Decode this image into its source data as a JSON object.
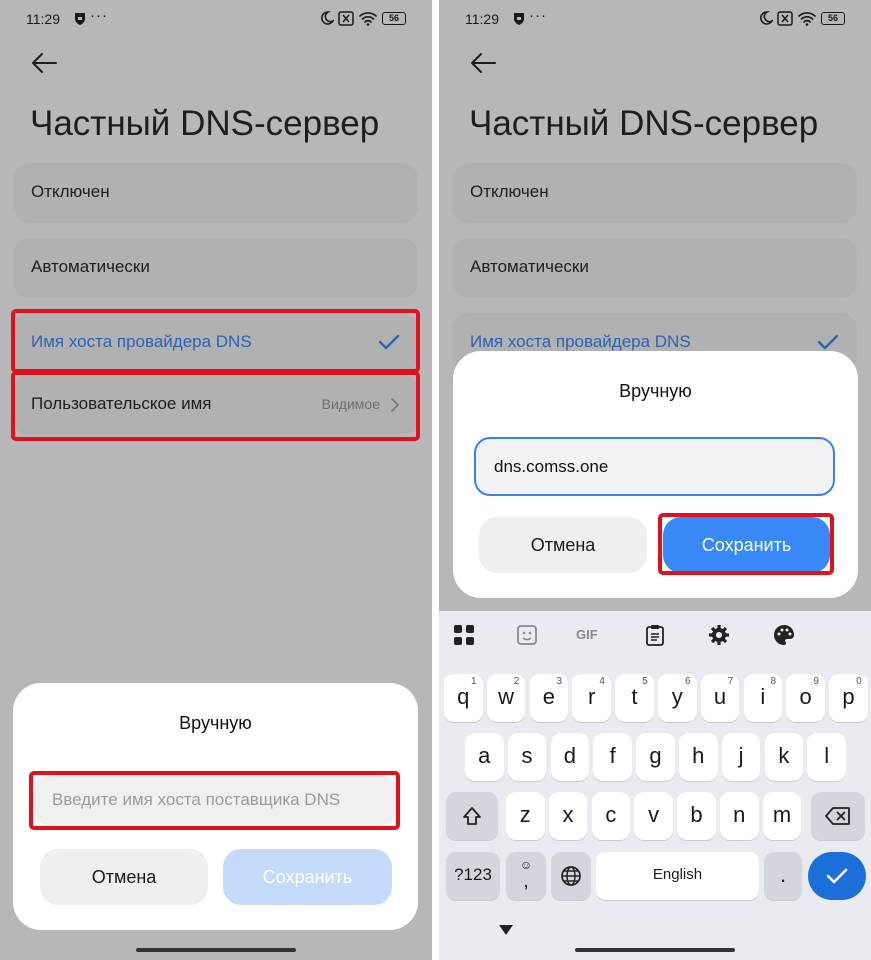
{
  "status": {
    "time": "11:29",
    "dots": "···",
    "battery": "56"
  },
  "screen": {
    "title": "Частный DNS-сервер",
    "options": [
      {
        "label": "Отключен"
      },
      {
        "label": "Автоматически"
      },
      {
        "label": "Имя хоста провайдера DNS"
      },
      {
        "label": "Пользовательское имя",
        "value": "Видимое"
      }
    ]
  },
  "dialog_left": {
    "title": "Вручную",
    "placeholder": "Введите имя хоста поставщика DNS",
    "cancel": "Отмена",
    "save": "Сохранить"
  },
  "dialog_right": {
    "title": "Вручную",
    "input_value": "dns.comss.one",
    "cancel": "Отмена",
    "save": "Сохранить"
  },
  "keyboard": {
    "toolbar_icons": [
      "apps-grid-icon",
      "sticker-icon",
      "gif-icon",
      "clipboard-icon",
      "settings-gear-icon",
      "theme-palette-icon"
    ],
    "gif_label": "GIF",
    "row1": [
      {
        "k": "q",
        "h": "1"
      },
      {
        "k": "w",
        "h": "2"
      },
      {
        "k": "e",
        "h": "3"
      },
      {
        "k": "r",
        "h": "4"
      },
      {
        "k": "t",
        "h": "5"
      },
      {
        "k": "y",
        "h": "6"
      },
      {
        "k": "u",
        "h": "7"
      },
      {
        "k": "i",
        "h": "8"
      },
      {
        "k": "o",
        "h": "9"
      },
      {
        "k": "p",
        "h": "0"
      }
    ],
    "row2": [
      "a",
      "s",
      "d",
      "f",
      "g",
      "h",
      "j",
      "k",
      "l"
    ],
    "row3": [
      "z",
      "x",
      "c",
      "v",
      "b",
      "n",
      "m"
    ],
    "symbols_label": "?123",
    "comma_label": ",",
    "emoji_label": "☺",
    "space_label": "English",
    "period_label": "."
  },
  "colors": {
    "accent": "#3888f6",
    "selected_text": "#2b63b3",
    "highlight": "#e0101c",
    "backdrop": "#b7b7b7"
  }
}
